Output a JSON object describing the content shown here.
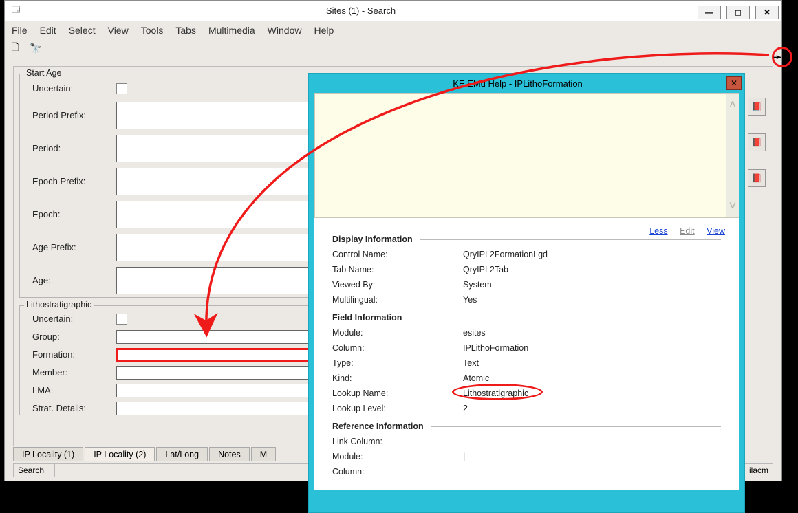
{
  "titlebar": {
    "title": "Sites (1) - Search"
  },
  "menu": {
    "file": "File",
    "edit": "Edit",
    "select": "Select",
    "view": "View",
    "tools": "Tools",
    "tabs": "Tabs",
    "multimedia": "Multimedia",
    "window": "Window",
    "help": "Help"
  },
  "startAge": {
    "legend": "Start Age",
    "uncertain": "Uncertain:",
    "periodPrefix": "Period Prefix:",
    "period": "Period:",
    "epochPrefix": "Epoch Prefix:",
    "epoch": "Epoch:",
    "agePrefix": "Age Prefix:",
    "age": "Age:"
  },
  "litho": {
    "legend": "Lithostratigraphic",
    "uncertain": "Uncertain:",
    "group": "Group:",
    "formation": "Formation:",
    "member": "Member:",
    "lma": "LMA:",
    "strat": "Strat. Details:"
  },
  "tabs": {
    "t1": "IP Locality (1)",
    "t2": "IP Locality (2)",
    "t3": "Lat/Long",
    "t4": "Notes",
    "t5": "M"
  },
  "bottom": {
    "search": "Search",
    "right": "ilacm"
  },
  "help": {
    "title": "KE EMu Help - IPLithoFormation",
    "actions": {
      "less": "Less",
      "edit": "Edit",
      "view": "View"
    },
    "display": {
      "hdr": "Display Information",
      "controlK": "Control Name:",
      "controlV": "QryIPL2FormationLgd",
      "tabK": "Tab Name:",
      "tabV": "QryIPL2Tab",
      "viewedK": "Viewed By:",
      "viewedV": "System",
      "multiK": "Multilingual:",
      "multiV": "Yes"
    },
    "field": {
      "hdr": "Field Information",
      "moduleK": "Module:",
      "moduleV": "esites",
      "columnK": "Column:",
      "columnV": "IPLithoFormation",
      "typeK": "Type:",
      "typeV": "Text",
      "kindK": "Kind:",
      "kindV": "Atomic",
      "lookNameK": "Lookup Name:",
      "lookNameV": "Lithostratigraphic",
      "lookLvlK": "Lookup Level:",
      "lookLvlV": "2"
    },
    "ref": {
      "hdr": "Reference Information",
      "linkK": "Link Column:",
      "linkV": "",
      "moduleK": "Module:",
      "moduleV": "|",
      "columnK": "Column:",
      "columnV": ""
    }
  },
  "helpCursor": "?"
}
